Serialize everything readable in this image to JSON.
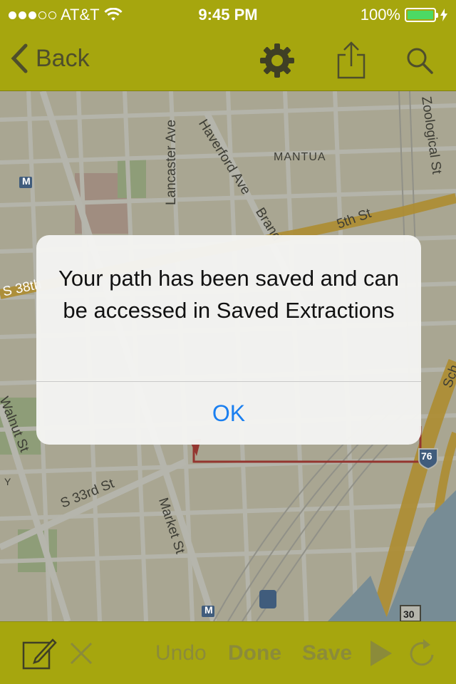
{
  "status_bar": {
    "carrier": "AT&T",
    "time": "9:45 PM",
    "battery": "100%"
  },
  "nav": {
    "back_label": "Back",
    "icons": [
      "chevron-left-icon",
      "gear-icon",
      "share-icon",
      "search-icon"
    ]
  },
  "map": {
    "labels": {
      "lancaster": "Lancaster Ave",
      "haverford": "Haverford Ave",
      "mantua": "MANTUA",
      "zoological": "Zoological St",
      "brand": "Brand",
      "fifth": "5th St",
      "s38": "S 38th",
      "walnut": "Walnut St",
      "s33": "S 33rd St",
      "market": "Market St",
      "sch": "Sch",
      "highway76": "76",
      "highway30": "30",
      "metro": "M",
      "y": "Y"
    },
    "colors": {
      "route": "#c4161c",
      "highway": "#f2b51e",
      "water": "#8fb4d6"
    }
  },
  "alert": {
    "message": "Your path has been saved and can be accessed in Saved Extractions",
    "ok_label": "OK"
  },
  "toolbar": {
    "undo_label": "Undo",
    "done_label": "Done",
    "save_label": "Save"
  },
  "colors": {
    "bar": "#a6a60e",
    "alert_button": "#1a7ff0"
  }
}
